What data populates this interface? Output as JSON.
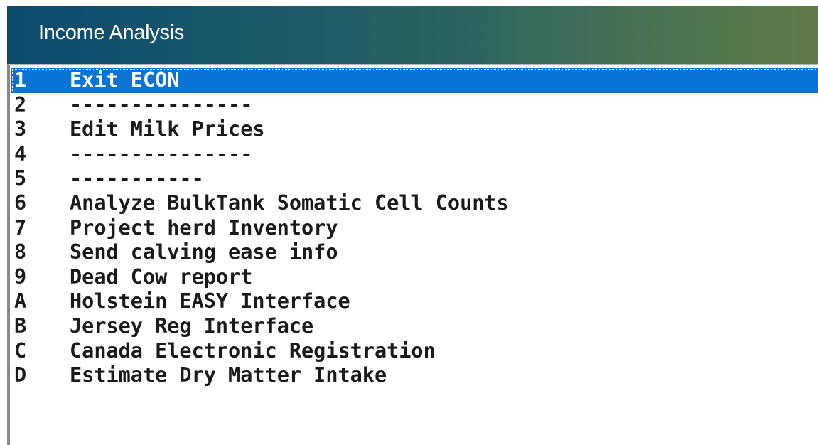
{
  "window": {
    "title": "Income Analysis"
  },
  "menu": {
    "selected_index": 0,
    "items": [
      {
        "key": "1",
        "label": "Exit ECON"
      },
      {
        "key": "2",
        "label": "---------------"
      },
      {
        "key": "3",
        "label": "Edit Milk Prices"
      },
      {
        "key": "4",
        "label": "---------------"
      },
      {
        "key": "5",
        "label": "-----------"
      },
      {
        "key": "6",
        "label": "Analyze BulkTank Somatic Cell Counts"
      },
      {
        "key": "7",
        "label": "Project herd Inventory"
      },
      {
        "key": "8",
        "label": "Send calving ease info"
      },
      {
        "key": "9",
        "label": "Dead Cow report"
      },
      {
        "key": "A",
        "label": "Holstein EASY Interface"
      },
      {
        "key": "B",
        "label": "Jersey Reg Interface"
      },
      {
        "key": "C",
        "label": "Canada Electronic Registration"
      },
      {
        "key": "D",
        "label": "Estimate Dry Matter Intake"
      }
    ]
  },
  "colors": {
    "title_gradient_start": "#0e4a6e",
    "title_gradient_end": "#5f7b48",
    "selection": "#0a74d6"
  }
}
